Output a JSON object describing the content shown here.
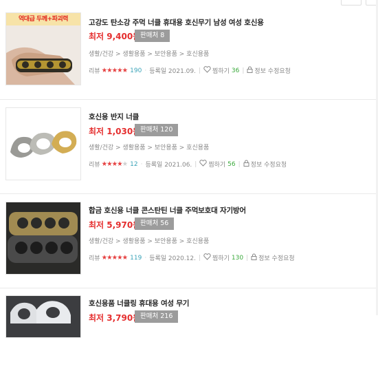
{
  "items": [
    {
      "badge": "역대급 두께+파괴력",
      "title": "고강도 탄소강 주먹 너클 휴대용 호신무기 남성 여성 호신용",
      "price": "최저 9,400원",
      "sellers": "판매처 8",
      "category": "생활/건강 > 생활용품 > 보안용품 > 호신용품",
      "review_label": "리뷰",
      "rating": 5,
      "review_count": "190",
      "reg": "등록일 2021.09.",
      "zzim_label": "찜하기",
      "zzim_count": "36",
      "fix": "정보 수정요청"
    },
    {
      "badge": "",
      "title": "호신용 반지 너클",
      "price": "최저 1,030원",
      "sellers": "판매처 120",
      "category": "생활/건강 > 생활용품 > 보안용품 > 호신용품",
      "review_label": "리뷰",
      "rating": 4,
      "review_count": "12",
      "reg": "등록일 2021.06.",
      "zzim_label": "찜하기",
      "zzim_count": "56",
      "fix": "정보 수정요청"
    },
    {
      "badge": "",
      "title": "합금 호신용 너클 콘스탄틴 너클 주먹보호대 자기방어",
      "price": "최저 5,970원",
      "sellers": "판매처 56",
      "category": "생활/건강 > 생활용품 > 보안용품 > 호신용품",
      "review_label": "리뷰",
      "rating": 5,
      "review_count": "119",
      "reg": "등록일 2020.12.",
      "zzim_label": "찜하기",
      "zzim_count": "130",
      "fix": "정보 수정요청"
    },
    {
      "badge": "",
      "title": "호신용품 너클링 휴대용 여성 무기",
      "price": "최저 3,790원",
      "sellers": "판매처 216",
      "category": "",
      "review_label": "",
      "rating": 0,
      "review_count": "",
      "reg": "",
      "zzim_label": "",
      "zzim_count": "",
      "fix": ""
    }
  ],
  "colors": {
    "price": "#e52f2f",
    "star": "#e64141",
    "review_count": "#3aa3b8",
    "zzim_count": "#39a93a",
    "seller_badge": "#9c9c9c"
  },
  "icons": [
    "heart-icon",
    "lock-icon"
  ]
}
